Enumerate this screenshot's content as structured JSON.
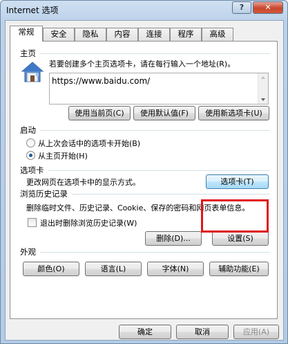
{
  "window": {
    "title": "Internet 选项",
    "help_label": "?",
    "close_label": "✕"
  },
  "tabs": [
    "常规",
    "安全",
    "隐私",
    "内容",
    "连接",
    "程序",
    "高级"
  ],
  "homepage": {
    "heading": "主页",
    "description": "若要创建多个主页选项卡，请在每行输入一个地址(R)。",
    "url": "https://www.baidu.com/",
    "btn_current": "使用当前页(C)",
    "btn_default": "使用默认值(F)",
    "btn_newtab": "使用新选项卡(U)"
  },
  "startup": {
    "heading": "启动",
    "option_last": "从上次会话中的选项卡开始(B)",
    "option_home": "从主页开始(H)",
    "selected": "option_home"
  },
  "tabs_section": {
    "heading": "选项卡",
    "description": "更改网页在选项卡中的显示方式。",
    "button": "选项卡(T)"
  },
  "history": {
    "heading": "浏览历史记录",
    "description": "删除临时文件、历史记录、Cookie、保存的密码和网页表单信息。",
    "checkbox_label": "退出时删除浏览历史记录(W)",
    "checkbox_checked": false,
    "btn_delete": "删除(D)...",
    "btn_settings": "设置(S)"
  },
  "appearance": {
    "heading": "外观",
    "btn_colors": "颜色(O)",
    "btn_languages": "语言(L)",
    "btn_fonts": "字体(N)",
    "btn_accessibility": "辅助功能(E)"
  },
  "footer": {
    "ok": "确定",
    "cancel": "取消",
    "apply": "应用(A)"
  },
  "colors": {
    "highlight": "#e0141a",
    "radio_dot": "#1d5d9a"
  }
}
